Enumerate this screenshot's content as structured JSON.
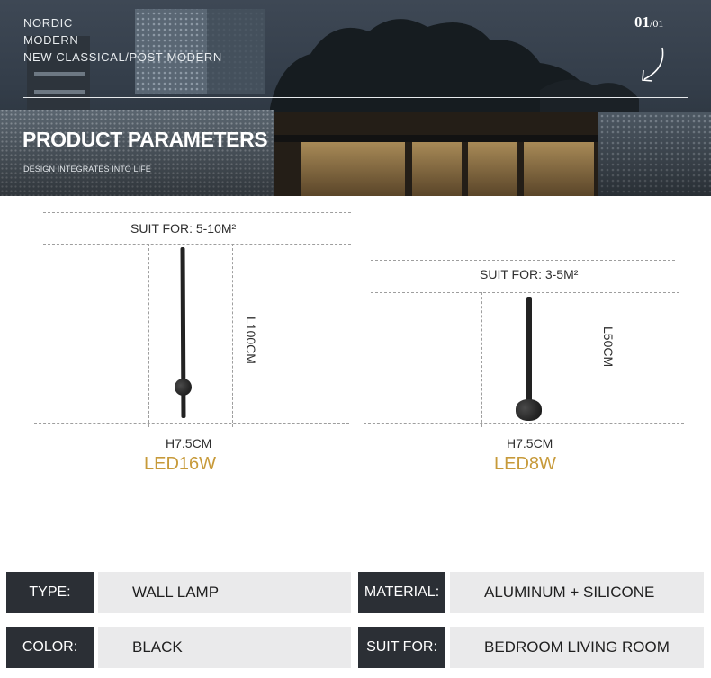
{
  "hero": {
    "tags": [
      "NORDIC",
      "MODERN",
      "NEW CLASSICAL/POST-MODERN"
    ],
    "title": "PRODUCT PARAMETERS",
    "subtitle": "DESIGN INTEGRATES INTO LIFE",
    "page_current": "01",
    "page_total": "/01",
    "arrow_icon": "curved-arrow-down-left-icon"
  },
  "products": [
    {
      "suit_for": "SUIT FOR:  5-10M²",
      "length": "L100CM",
      "height": "H7.5CM",
      "power": "LED16W"
    },
    {
      "suit_for": "SUIT FOR:  3-5M²",
      "length": "L50CM",
      "height": "H7.5CM",
      "power": "LED8W"
    }
  ],
  "specs": [
    {
      "key": "TYPE:",
      "value": "WALL LAMP"
    },
    {
      "key": "MATERIAL:",
      "value": "ALUMINUM + SILICONE"
    },
    {
      "key": "COLOR:",
      "value": "BLACK"
    },
    {
      "key": "SUIT FOR:",
      "value": "BEDROOM LIVING ROOM"
    }
  ],
  "colors": {
    "accent_gold": "#c79a3a",
    "key_cell_bg": "#2b2f35",
    "value_cell_bg": "#eaeaeb"
  }
}
